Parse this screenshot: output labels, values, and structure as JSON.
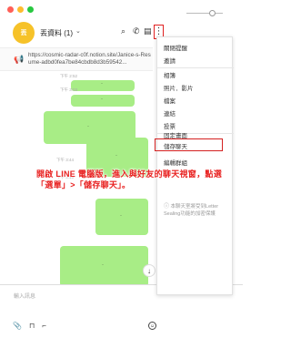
{
  "header": {
    "avatar_text": "丟",
    "title": "丟資料 (1)",
    "chevron": "⌄",
    "icons": [
      "search-icon",
      "phone-icon",
      "sidebar-icon",
      "more-icon"
    ],
    "search_glyph": "⌕",
    "phone_glyph": "✆",
    "sidebar_glyph": "▤",
    "more_glyph": "⋮"
  },
  "announcement": {
    "pin_glyph": "📢",
    "text": "https://cosmic-radar-c0f.notion.site/Janice-s-Resume-adbd0fea7be84cbdb8d3b59542..."
  },
  "chat": {
    "bubble_glyph": "·",
    "timestamps": [
      "下午 2:52",
      "下午 3:03",
      "下午 3:04",
      "下午 3:44",
      "下午 3:15"
    ],
    "scroll_glyph": "↓"
  },
  "menu": {
    "items": [
      "關閉提醒",
      "邀請",
      "相簿",
      "照片．影片",
      "檔案",
      "連結",
      "投票",
      "固定畫面",
      "儲存聊天",
      "編輯群組"
    ],
    "note_icon": "ⓘ",
    "note": "本聊天室將受到Letter Sealing功能的加密保護"
  },
  "input": {
    "placeholder": "輸入訊息",
    "attach_glyph": "📎",
    "bookmark_glyph": "⊓",
    "crop_glyph": "⌐",
    "emoji_glyph": "☺"
  },
  "annotation": "開啟 LINE 電腦版，進入與好友的聊天視窗，點選「選單」>「儲存聊天」。",
  "colors": {
    "bubble": "#a8ed86",
    "highlight": "#d42020",
    "annotation": "#e8201f",
    "avatar": "#f6c229"
  }
}
